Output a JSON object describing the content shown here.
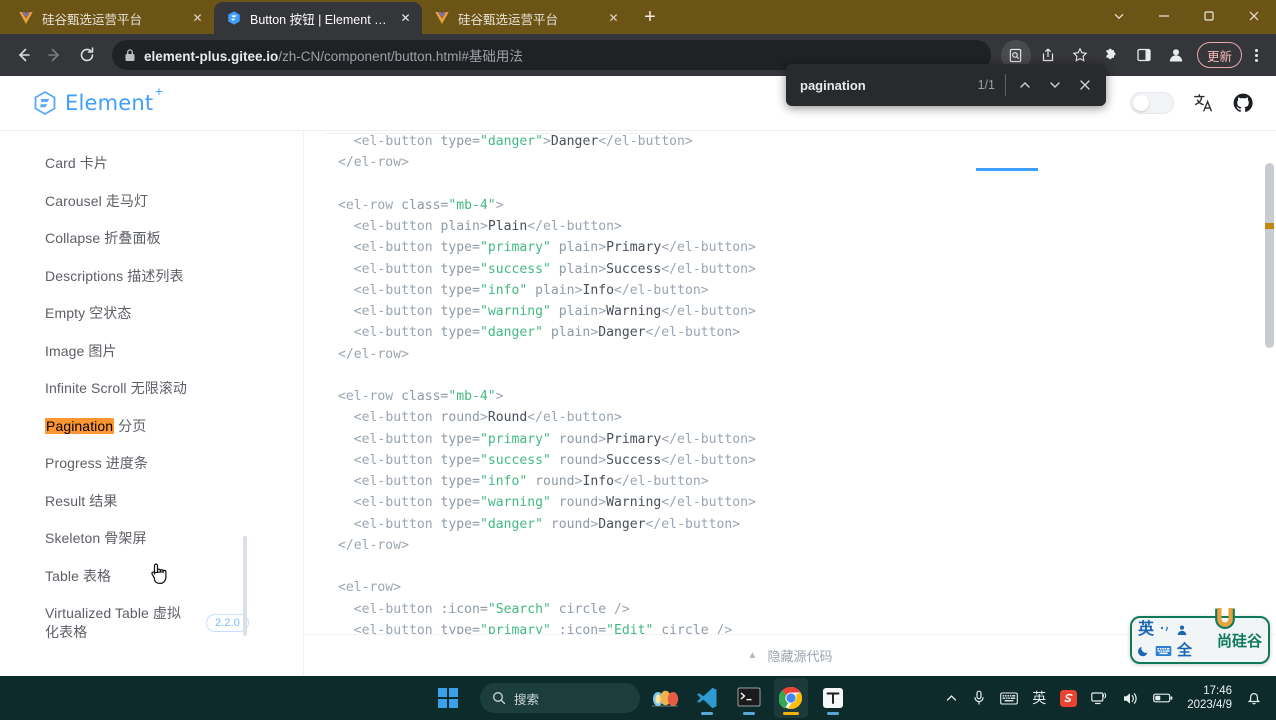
{
  "browser": {
    "tabs": [
      {
        "title": "硅谷甄选运营平台",
        "favicon": "vue-icon",
        "active": false
      },
      {
        "title": "Button 按钮 | Element Plus",
        "favicon": "element-icon",
        "active": true
      },
      {
        "title": "硅谷甄选运营平台",
        "favicon": "vue-icon",
        "active": false
      }
    ],
    "new_tab_label": "+",
    "window_controls": [
      "tab-search-chevron",
      "minimize",
      "maximize",
      "close"
    ],
    "nav": {
      "back": "←",
      "forward": "→",
      "reload": "⟳"
    },
    "omnibox": {
      "lock_icon": "lock-icon",
      "url_domain": "element-plus.gitee.io",
      "url_path": "/zh-CN/component/button.html#基础用法"
    },
    "toolbar_icons": [
      "reading-mode-icon",
      "share-icon",
      "bookmark-star-icon",
      "extensions-puzzle-icon",
      "side-panel-icon",
      "profile-avatar-icon"
    ],
    "update_button": "更新",
    "menu": "kebab-menu-icon"
  },
  "findbar": {
    "query": "pagination",
    "count": "1/1",
    "prev": "previous-match",
    "next": "next-match",
    "close": "close-find"
  },
  "site": {
    "brand": "Element",
    "brand_sup": "+",
    "header_icons": [
      "theme-toggle",
      "translate-icon",
      "github-icon"
    ]
  },
  "sidebar": {
    "items": [
      {
        "label": "Card 卡片"
      },
      {
        "label": "Carousel 走马灯"
      },
      {
        "label": "Collapse 折叠面板"
      },
      {
        "label": "Descriptions 描述列表"
      },
      {
        "label": "Empty 空状态"
      },
      {
        "label": "Image 图片"
      },
      {
        "label": "Infinite Scroll 无限滚动"
      },
      {
        "label": "Pagination 分页",
        "highlight": "Pagination",
        "rest": " 分页"
      },
      {
        "label": "Progress 进度条"
      },
      {
        "label": "Result 结果"
      },
      {
        "label": "Skeleton 骨架屏"
      },
      {
        "label": "Table 表格"
      },
      {
        "label": "Virtualized Table 虚拟化表格",
        "badge": "2.2.0"
      }
    ]
  },
  "code": {
    "lines": [
      [
        {
          "t": "  ",
          "c": "c-txt"
        },
        {
          "t": "<el-button",
          "c": "c-tag"
        },
        {
          "t": " type=",
          "c": "c-attr"
        },
        {
          "t": "\"danger\"",
          "c": "c-str"
        },
        {
          "t": ">",
          "c": "c-tag"
        },
        {
          "t": "Danger",
          "c": "c-txt"
        },
        {
          "t": "</el-button>",
          "c": "c-tag"
        }
      ],
      [
        {
          "t": "</el-row>",
          "c": "c-tag"
        }
      ],
      [
        {
          "t": "",
          "c": "c-txt"
        }
      ],
      [
        {
          "t": "<el-row",
          "c": "c-tag"
        },
        {
          "t": " class=",
          "c": "c-attr"
        },
        {
          "t": "\"mb-4\"",
          "c": "c-str"
        },
        {
          "t": ">",
          "c": "c-tag"
        }
      ],
      [
        {
          "t": "  ",
          "c": "c-txt"
        },
        {
          "t": "<el-button",
          "c": "c-tag"
        },
        {
          "t": " plain",
          "c": "c-attr"
        },
        {
          "t": ">",
          "c": "c-tag"
        },
        {
          "t": "Plain",
          "c": "c-txt"
        },
        {
          "t": "</el-button>",
          "c": "c-tag"
        }
      ],
      [
        {
          "t": "  ",
          "c": "c-txt"
        },
        {
          "t": "<el-button",
          "c": "c-tag"
        },
        {
          "t": " type=",
          "c": "c-attr"
        },
        {
          "t": "\"primary\"",
          "c": "c-str"
        },
        {
          "t": " plain",
          "c": "c-attr"
        },
        {
          "t": ">",
          "c": "c-tag"
        },
        {
          "t": "Primary",
          "c": "c-txt"
        },
        {
          "t": "</el-button>",
          "c": "c-tag"
        }
      ],
      [
        {
          "t": "  ",
          "c": "c-txt"
        },
        {
          "t": "<el-button",
          "c": "c-tag"
        },
        {
          "t": " type=",
          "c": "c-attr"
        },
        {
          "t": "\"success\"",
          "c": "c-str"
        },
        {
          "t": " plain",
          "c": "c-attr"
        },
        {
          "t": ">",
          "c": "c-tag"
        },
        {
          "t": "Success",
          "c": "c-txt"
        },
        {
          "t": "</el-button>",
          "c": "c-tag"
        }
      ],
      [
        {
          "t": "  ",
          "c": "c-txt"
        },
        {
          "t": "<el-button",
          "c": "c-tag"
        },
        {
          "t": " type=",
          "c": "c-attr"
        },
        {
          "t": "\"info\"",
          "c": "c-str"
        },
        {
          "t": " plain",
          "c": "c-attr"
        },
        {
          "t": ">",
          "c": "c-tag"
        },
        {
          "t": "Info",
          "c": "c-txt"
        },
        {
          "t": "</el-button>",
          "c": "c-tag"
        }
      ],
      [
        {
          "t": "  ",
          "c": "c-txt"
        },
        {
          "t": "<el-button",
          "c": "c-tag"
        },
        {
          "t": " type=",
          "c": "c-attr"
        },
        {
          "t": "\"warning\"",
          "c": "c-str"
        },
        {
          "t": " plain",
          "c": "c-attr"
        },
        {
          "t": ">",
          "c": "c-tag"
        },
        {
          "t": "Warning",
          "c": "c-txt"
        },
        {
          "t": "</el-button>",
          "c": "c-tag"
        }
      ],
      [
        {
          "t": "  ",
          "c": "c-txt"
        },
        {
          "t": "<el-button",
          "c": "c-tag"
        },
        {
          "t": " type=",
          "c": "c-attr"
        },
        {
          "t": "\"danger\"",
          "c": "c-str"
        },
        {
          "t": " plain",
          "c": "c-attr"
        },
        {
          "t": ">",
          "c": "c-tag"
        },
        {
          "t": "Danger",
          "c": "c-txt"
        },
        {
          "t": "</el-button>",
          "c": "c-tag"
        }
      ],
      [
        {
          "t": "</el-row>",
          "c": "c-tag"
        }
      ],
      [
        {
          "t": "",
          "c": "c-txt"
        }
      ],
      [
        {
          "t": "<el-row",
          "c": "c-tag"
        },
        {
          "t": " class=",
          "c": "c-attr"
        },
        {
          "t": "\"mb-4\"",
          "c": "c-str"
        },
        {
          "t": ">",
          "c": "c-tag"
        }
      ],
      [
        {
          "t": "  ",
          "c": "c-txt"
        },
        {
          "t": "<el-button",
          "c": "c-tag"
        },
        {
          "t": " round",
          "c": "c-attr"
        },
        {
          "t": ">",
          "c": "c-tag"
        },
        {
          "t": "Round",
          "c": "c-txt"
        },
        {
          "t": "</el-button>",
          "c": "c-tag"
        }
      ],
      [
        {
          "t": "  ",
          "c": "c-txt"
        },
        {
          "t": "<el-button",
          "c": "c-tag"
        },
        {
          "t": " type=",
          "c": "c-attr"
        },
        {
          "t": "\"primary\"",
          "c": "c-str"
        },
        {
          "t": " round",
          "c": "c-attr"
        },
        {
          "t": ">",
          "c": "c-tag"
        },
        {
          "t": "Primary",
          "c": "c-txt"
        },
        {
          "t": "</el-button>",
          "c": "c-tag"
        }
      ],
      [
        {
          "t": "  ",
          "c": "c-txt"
        },
        {
          "t": "<el-button",
          "c": "c-tag"
        },
        {
          "t": " type=",
          "c": "c-attr"
        },
        {
          "t": "\"success\"",
          "c": "c-str"
        },
        {
          "t": " round",
          "c": "c-attr"
        },
        {
          "t": ">",
          "c": "c-tag"
        },
        {
          "t": "Success",
          "c": "c-txt"
        },
        {
          "t": "</el-button>",
          "c": "c-tag"
        }
      ],
      [
        {
          "t": "  ",
          "c": "c-txt"
        },
        {
          "t": "<el-button",
          "c": "c-tag"
        },
        {
          "t": " type=",
          "c": "c-attr"
        },
        {
          "t": "\"info\"",
          "c": "c-str"
        },
        {
          "t": " round",
          "c": "c-attr"
        },
        {
          "t": ">",
          "c": "c-tag"
        },
        {
          "t": "Info",
          "c": "c-txt"
        },
        {
          "t": "</el-button>",
          "c": "c-tag"
        }
      ],
      [
        {
          "t": "  ",
          "c": "c-txt"
        },
        {
          "t": "<el-button",
          "c": "c-tag"
        },
        {
          "t": " type=",
          "c": "c-attr"
        },
        {
          "t": "\"warning\"",
          "c": "c-str"
        },
        {
          "t": " round",
          "c": "c-attr"
        },
        {
          "t": ">",
          "c": "c-tag"
        },
        {
          "t": "Warning",
          "c": "c-txt"
        },
        {
          "t": "</el-button>",
          "c": "c-tag"
        }
      ],
      [
        {
          "t": "  ",
          "c": "c-txt"
        },
        {
          "t": "<el-button",
          "c": "c-tag"
        },
        {
          "t": " type=",
          "c": "c-attr"
        },
        {
          "t": "\"danger\"",
          "c": "c-str"
        },
        {
          "t": " round",
          "c": "c-attr"
        },
        {
          "t": ">",
          "c": "c-tag"
        },
        {
          "t": "Danger",
          "c": "c-txt"
        },
        {
          "t": "</el-button>",
          "c": "c-tag"
        }
      ],
      [
        {
          "t": "</el-row>",
          "c": "c-tag"
        }
      ],
      [
        {
          "t": "",
          "c": "c-txt"
        }
      ],
      [
        {
          "t": "<el-row>",
          "c": "c-tag"
        }
      ],
      [
        {
          "t": "  ",
          "c": "c-txt"
        },
        {
          "t": "<el-button",
          "c": "c-tag"
        },
        {
          "t": " :icon=",
          "c": "c-attr"
        },
        {
          "t": "\"Search\"",
          "c": "c-str"
        },
        {
          "t": " circle",
          "c": "c-attr"
        },
        {
          "t": " />",
          "c": "c-tag"
        }
      ],
      [
        {
          "t": "  ",
          "c": "c-txt"
        },
        {
          "t": "<el-button",
          "c": "c-tag"
        },
        {
          "t": " type=",
          "c": "c-attr"
        },
        {
          "t": "\"primary\"",
          "c": "c-str"
        },
        {
          "t": " :icon=",
          "c": "c-attr"
        },
        {
          "t": "\"Edit\"",
          "c": "c-str"
        },
        {
          "t": " circle",
          "c": "c-attr"
        },
        {
          "t": " />",
          "c": "c-tag"
        }
      ]
    ]
  },
  "footer": {
    "toggle_source_label": "隐藏源代码",
    "caret": "▲"
  },
  "ime": {
    "mode": "英",
    "full_width": "全",
    "brand": "尚硅谷"
  },
  "taskbar": {
    "start": "windows-start-icon",
    "search_placeholder": "搜索",
    "apps": [
      "weather-widget",
      "vscode-icon",
      "terminal-icon",
      "chrome-icon",
      "typora-icon"
    ],
    "tray": [
      "chevron-up-icon",
      "mic-icon",
      "keyboard-icon",
      "ime-english-icon",
      "sogou-icon",
      "network-icon",
      "volume-icon",
      "battery-icon"
    ],
    "tray_ime_char": "英",
    "time": "17:46",
    "date": "2023/4/9",
    "notification": "notification-bell-icon"
  }
}
